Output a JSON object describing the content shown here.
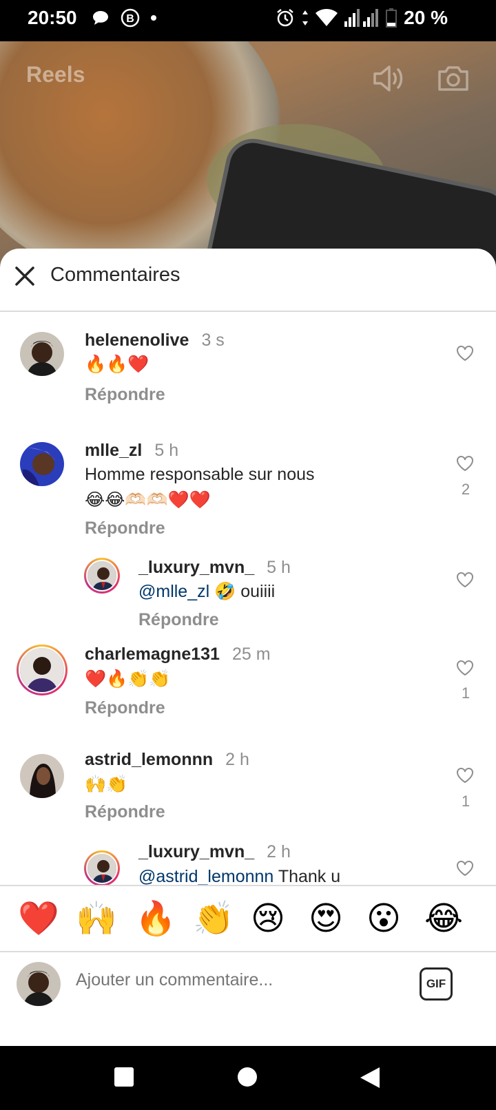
{
  "status_bar": {
    "time": "20:50",
    "battery": "20 %"
  },
  "video": {
    "title": "Reels"
  },
  "sheet": {
    "title": "Commentaires"
  },
  "comments": [
    {
      "user": "helenenolive",
      "time": "3 s",
      "text": "🔥🔥❤️",
      "reply": "Répondre",
      "likes": ""
    },
    {
      "user": "mlle_zl",
      "time": "5 h",
      "text": "Homme responsable sur nous",
      "text2": "😂😂🫶🏻🫶🏻❤️❤️",
      "reply": "Répondre",
      "likes": "2"
    },
    {
      "user": "_luxury_mvn_",
      "time": "5 h",
      "mention": "@mlle_zl",
      "text": " 🤣 ouiiii",
      "reply": "Répondre",
      "likes": ""
    },
    {
      "user": "charlemagne131",
      "time": "25 m",
      "text": "❤️🔥👏👏",
      "reply": "Répondre",
      "likes": "1"
    },
    {
      "user": "astrid_lemonnn",
      "time": "2 h",
      "text": "🙌👏",
      "reply": "Répondre",
      "likes": "1"
    },
    {
      "user": "_luxury_mvn_",
      "time": "2 h",
      "mention": "@astrid_lemonnn",
      "text": " Thank u",
      "reply": "",
      "likes": ""
    }
  ],
  "emoji_bar": [
    "❤️",
    "🙌",
    "🔥",
    "👏",
    "😢",
    "😍",
    "😮",
    "😂"
  ],
  "composer": {
    "placeholder": "Ajouter un commentaire...",
    "gif_label": "GIF"
  }
}
